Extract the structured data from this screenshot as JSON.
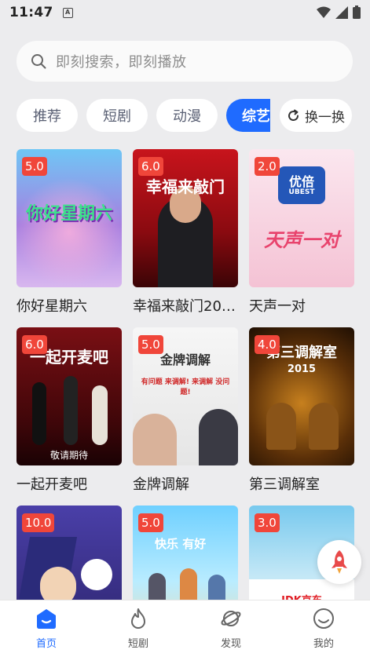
{
  "status_bar": {
    "time": "11:47",
    "a_icon": "A"
  },
  "search": {
    "placeholder": "即刻搜索，即刻播放"
  },
  "tabs": [
    {
      "label": "推荐"
    },
    {
      "label": "短剧"
    },
    {
      "label": "动漫"
    },
    {
      "label": "综艺"
    }
  ],
  "refresh": {
    "label": "换一换"
  },
  "cards": [
    {
      "title": "你好星期六",
      "score": "5.0",
      "poster_text": "你好星期六"
    },
    {
      "title": "幸福来敲门20…",
      "score": "6.0",
      "poster_text": "幸福来敲门"
    },
    {
      "title": "天声一对",
      "score": "2.0",
      "poster_text": "天声一对",
      "poster_brand": "优倍",
      "poster_brand_en": "UBEST"
    },
    {
      "title": "一起开麦吧",
      "score": "6.0",
      "poster_text": "一起开麦吧",
      "poster_caption": "敬请期待"
    },
    {
      "title": "金牌调解",
      "score": "5.0",
      "poster_text": "金牌调解",
      "poster_caption": "有问题 来调解! 来调解 没问题!"
    },
    {
      "title": "第三调解室",
      "score": "4.0",
      "poster_text": "第三调解室",
      "poster_year": "2015"
    },
    {
      "title": "",
      "score": "10.0",
      "poster_text": ""
    },
    {
      "title": "",
      "score": "5.0",
      "poster_text": "快乐 有好"
    },
    {
      "title": "",
      "score": "3.0",
      "poster_text": "JDK京东"
    }
  ],
  "bottom_nav": [
    {
      "label": "首页",
      "icon": "home-icon",
      "active": true
    },
    {
      "label": "短剧",
      "icon": "flame-icon",
      "active": false
    },
    {
      "label": "发现",
      "icon": "planet-icon",
      "active": false
    },
    {
      "label": "我的",
      "icon": "smiley-icon",
      "active": false
    }
  ],
  "colors": {
    "accent": "#1f6bff",
    "badge": "#f0463a",
    "background": "#ececee"
  }
}
